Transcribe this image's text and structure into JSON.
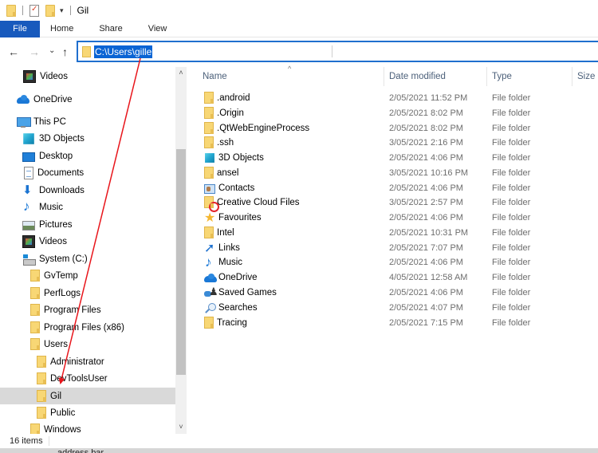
{
  "window": {
    "title": "Gil",
    "quick_access": [
      {
        "icon": "folder-icon"
      },
      {
        "icon": "properties-icon"
      },
      {
        "icon": "new-folder-icon"
      },
      {
        "icon": "customize-dropdown-icon"
      }
    ]
  },
  "ribbon": {
    "tabs": [
      {
        "label": "File",
        "active": true
      },
      {
        "label": "Home"
      },
      {
        "label": "Share"
      },
      {
        "label": "View"
      }
    ],
    "file_color": "#185abd"
  },
  "address_bar": {
    "path": "C:\\Users\\gille",
    "selected": true,
    "border_color": "#1f6fce",
    "selection_color": "#0a64d4"
  },
  "nav_buttons": {
    "back": "←",
    "forward": "→",
    "recent": "⌄",
    "up": "↑"
  },
  "navigation_pane": {
    "items": [
      {
        "label": "Videos",
        "icon": "videos-icon",
        "level": 2
      },
      {
        "label": "OneDrive",
        "icon": "onedrive-icon",
        "level": 1
      },
      {
        "label": "This PC",
        "icon": "this-pc-icon",
        "level": 1
      },
      {
        "label": "3D Objects",
        "icon": "3d-objects-icon",
        "level": 2
      },
      {
        "label": "Desktop",
        "icon": "desktop-icon",
        "level": 2
      },
      {
        "label": "Documents",
        "icon": "documents-icon",
        "level": 2
      },
      {
        "label": "Downloads",
        "icon": "downloads-icon",
        "level": 2
      },
      {
        "label": "Music",
        "icon": "music-icon",
        "level": 2
      },
      {
        "label": "Pictures",
        "icon": "pictures-icon",
        "level": 2
      },
      {
        "label": "Videos",
        "icon": "videos-icon",
        "level": 2
      },
      {
        "label": "System (C:)",
        "icon": "drive-icon",
        "level": 2
      },
      {
        "label": "GvTemp",
        "icon": "folder-icon",
        "level": 3
      },
      {
        "label": "PerfLogs",
        "icon": "folder-icon",
        "level": 3
      },
      {
        "label": "Program Files",
        "icon": "folder-icon",
        "level": 3
      },
      {
        "label": "Program Files (x86)",
        "icon": "folder-icon",
        "level": 3
      },
      {
        "label": "Users",
        "icon": "folder-icon",
        "level": 3
      },
      {
        "label": "Administrator",
        "icon": "folder-icon",
        "level": 4
      },
      {
        "label": "DevToolsUser",
        "icon": "folder-icon",
        "level": 4
      },
      {
        "label": "Gil",
        "icon": "folder-icon",
        "level": 4,
        "selected": true
      },
      {
        "label": "Public",
        "icon": "folder-icon",
        "level": 4
      },
      {
        "label": "Windows",
        "icon": "folder-icon",
        "level": 3
      }
    ],
    "scrollbar": {
      "up": "˄",
      "down": "˅"
    }
  },
  "file_list": {
    "columns": [
      "Name",
      "Date modified",
      "Type",
      "Size"
    ],
    "sort_indicator": "^",
    "rows": [
      {
        "name": ".android",
        "date": "2/05/2021 11:52 PM",
        "type": "File folder",
        "icon": "folder-icon"
      },
      {
        "name": ".Origin",
        "date": "2/05/2021 8:02 PM",
        "type": "File folder",
        "icon": "folder-icon"
      },
      {
        "name": ".QtWebEngineProcess",
        "date": "2/05/2021 8:02 PM",
        "type": "File folder",
        "icon": "folder-icon"
      },
      {
        "name": ".ssh",
        "date": "3/05/2021 2:16 PM",
        "type": "File folder",
        "icon": "folder-icon"
      },
      {
        "name": "3D Objects",
        "date": "2/05/2021 4:06 PM",
        "type": "File folder",
        "icon": "3d-objects-icon"
      },
      {
        "name": "ansel",
        "date": "3/05/2021 10:16 PM",
        "type": "File folder",
        "icon": "folder-icon"
      },
      {
        "name": "Contacts",
        "date": "2/05/2021 4:06 PM",
        "type": "File folder",
        "icon": "contacts-icon"
      },
      {
        "name": "Creative Cloud Files",
        "date": "3/05/2021 2:57 PM",
        "type": "File folder",
        "icon": "creative-cloud-folder-icon"
      },
      {
        "name": "Favourites",
        "date": "2/05/2021 4:06 PM",
        "type": "File folder",
        "icon": "favourites-star-icon"
      },
      {
        "name": "Intel",
        "date": "2/05/2021 10:31 PM",
        "type": "File folder",
        "icon": "folder-icon"
      },
      {
        "name": "Links",
        "date": "2/05/2021 7:07 PM",
        "type": "File folder",
        "icon": "links-icon"
      },
      {
        "name": "Music",
        "date": "2/05/2021 4:06 PM",
        "type": "File folder",
        "icon": "music-icon"
      },
      {
        "name": "OneDrive",
        "date": "4/05/2021 12:58 AM",
        "type": "File folder",
        "icon": "onedrive-icon"
      },
      {
        "name": "Saved Games",
        "date": "2/05/2021 4:06 PM",
        "type": "File folder",
        "icon": "saved-games-icon"
      },
      {
        "name": "Searches",
        "date": "2/05/2021 4:07 PM",
        "type": "File folder",
        "icon": "searches-icon"
      },
      {
        "name": "Tracing",
        "date": "2/05/2021 7:15 PM",
        "type": "File folder",
        "icon": "folder-icon"
      }
    ]
  },
  "status_bar": {
    "item_count": "16 items"
  },
  "below_window_text": "address bar",
  "annotation": {
    "type": "arrow",
    "color": "#e8151b",
    "from": "address-bar-path",
    "to": "nav-item-gil"
  }
}
